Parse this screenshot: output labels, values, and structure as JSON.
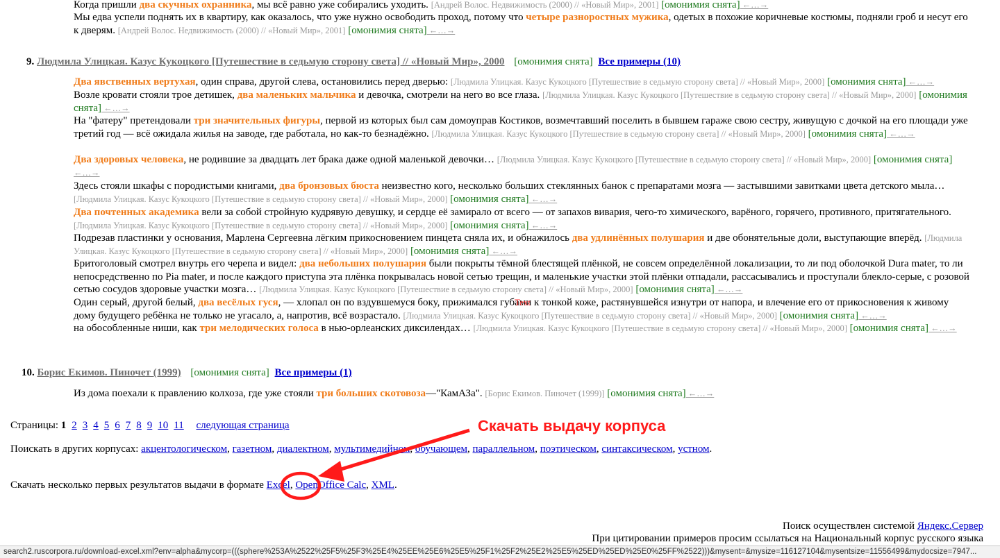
{
  "top_snippets": [
    {
      "parts": [
        {
          "t": "text",
          "v": "Когда пришли "
        },
        {
          "t": "kw",
          "v": "два скучных охранника"
        },
        {
          "t": "text",
          "v": ", мы всё равно уже собирались уходить. "
        },
        {
          "t": "src",
          "v": "[Андрей Волос. Недвижимость (2000) // «Новый Мир», 2001]"
        },
        {
          "t": "om",
          "v": " [омонимия снята]"
        },
        {
          "t": "arr",
          "v": " ←…→"
        }
      ]
    },
    {
      "parts": [
        {
          "t": "text",
          "v": "Мы едва успели поднять их в квартиру, как оказалось, что уже нужно освободить проход, потому что "
        },
        {
          "t": "kw",
          "v": "четыре разноростных мужика"
        },
        {
          "t": "text",
          "v": ", одетых в похожие коричневые костюмы, подняли гроб и несут его к дверям. "
        },
        {
          "t": "src",
          "v": "[Андрей Волос. Недвижимость (2000) // «Новый Мир», 2001]"
        },
        {
          "t": "om",
          "v": " [омонимия снята]"
        },
        {
          "t": "arr",
          "v": " ←…→"
        }
      ]
    }
  ],
  "doc9": {
    "number": "9.",
    "title": "Людмила Улицкая. Казус Кукоцкого [Путешествие в седьмую сторону света] // «Новый Мир», 2000",
    "omonimia": "[омонимия снята]",
    "all_examples": "Все примеры (10)",
    "snippets": [
      {
        "parts": [
          {
            "t": "kw",
            "v": "Два явственных вертухая"
          },
          {
            "t": "text",
            "v": ", один справа, другой слева, остановились перед дверью: "
          },
          {
            "t": "src",
            "v": "[Людмила Улицкая. Казус Кукоцкого [Путешествие в седьмую сторону света] // «Новый Мир», 2000]"
          },
          {
            "t": "om",
            "v": " [омонимия снята]"
          },
          {
            "t": "arr",
            "v": " ←…→"
          }
        ]
      },
      {
        "parts": [
          {
            "t": "text",
            "v": "Возле кровати стояли трое детишек, "
          },
          {
            "t": "kw",
            "v": "два маленьких мальчика"
          },
          {
            "t": "text",
            "v": " и девочка, смотрели на него во все глаза. "
          },
          {
            "t": "src",
            "v": "[Людмила Улицкая. Казус Кукоцкого [Путешествие в седьмую сторону света] // «Новый Мир», 2000]"
          },
          {
            "t": "om",
            "v": " [омонимия снята]"
          },
          {
            "t": "arr",
            "v": " ←…→"
          }
        ]
      },
      {
        "parts": [
          {
            "t": "text",
            "v": "На \"фатеру\" претендовали "
          },
          {
            "t": "kw",
            "v": "три значительных фигуры"
          },
          {
            "t": "text",
            "v": ", первой из которых был сам домоуправ Костиков, возмечтавший поселить в бывшем гараже свою сестру, живущую с дочкой на его площади уже третий год — всё ожидала жилья на заводе, где работала, но как-то безнадёжно. "
          },
          {
            "t": "src",
            "v": "[Людмила Улицкая. Казус Кукоцкого [Путешествие в седьмую сторону света] // «Новый Мир», 2000]"
          },
          {
            "t": "om",
            "v": " [омонимия снята]"
          },
          {
            "t": "arr",
            "v": " ←…→"
          }
        ]
      },
      {
        "parts": [
          {
            "t": "kw",
            "v": "Два здоровых человека"
          },
          {
            "t": "text",
            "v": ", не родившие за двадцать лет брака даже одной маленькой девочки… "
          },
          {
            "t": "src",
            "v": "[Людмила Улицкая. Казус Кукоцкого [Путешествие в седьмую сторону света] // «Новый Мир», 2000]"
          },
          {
            "t": "om",
            "v": " [омонимия снята]"
          },
          {
            "t": "arr",
            "v": " ←…→"
          }
        ]
      },
      {
        "parts": [
          {
            "t": "text",
            "v": "Здесь стояли шкафы с породистыми книгами, "
          },
          {
            "t": "kw",
            "v": "два бронзовых бюста"
          },
          {
            "t": "text",
            "v": " неизвестно кого, несколько больших стеклянных банок с препаратами мозга — застывшими завитками цвета детского мыла… "
          },
          {
            "t": "src",
            "v": "[Людмила Улицкая. Казус Кукоцкого [Путешествие в седьмую сторону света] // «Новый Мир», 2000]"
          },
          {
            "t": "om",
            "v": " [омонимия снята]"
          },
          {
            "t": "arr",
            "v": " ←…→"
          }
        ]
      },
      {
        "parts": [
          {
            "t": "kw",
            "v": "Два почтенных академика"
          },
          {
            "t": "text",
            "v": " вели за собой стройную кудрявую девушку, и сердце её замирало от всего — от запахов вивария, чего-то химического, варёного, горячего, противного, притягательного. "
          },
          {
            "t": "src",
            "v": "[Людмила Улицкая. Казус Кукоцкого [Путешествие в седьмую сторону света] // «Новый Мир», 2000]"
          },
          {
            "t": "om",
            "v": " [омонимия снята]"
          },
          {
            "t": "arr",
            "v": " ←…→"
          }
        ]
      },
      {
        "parts": [
          {
            "t": "text",
            "v": "Подрезав пластинки у основания, Марлена Сергеевна лёгким прикосновением пинцета сняла их, и обнажилось "
          },
          {
            "t": "kw",
            "v": "два удлинённых полушария"
          },
          {
            "t": "text",
            "v": " и две обонятельные доли, выступающие вперёд. "
          },
          {
            "t": "src",
            "v": "[Людмила Улицкая. Казус Кукоцкого [Путешествие в седьмую сторону света] // «Новый Мир», 2000]"
          },
          {
            "t": "om",
            "v": " [омонимия снята]"
          },
          {
            "t": "arr",
            "v": " ←…→"
          }
        ]
      },
      {
        "parts": [
          {
            "t": "text",
            "v": "Бритоголовый смотрел внутрь его черепа и видел: "
          },
          {
            "t": "kw",
            "v": "два небольших полушария"
          },
          {
            "t": "text",
            "v": " были покрыты тёмной блестящей плёнкой, не совсем определённой локализации, то ли под оболочкой Dura mater, то ли непосредственно по Pia mater, и после каждого приступа эта плёнка покрывалась новой сетью трещин, и маленькие участки этой плёнки отпадали, рассасывались и проступали блекло-серые, с розовой сетью сосудов здоровые участки мозга… "
          },
          {
            "t": "src",
            "v": "[Людмила Улицкая. Казус Кукоцкого [Путешествие в седьмую сторону света] // «Новый Мир», 2000]"
          },
          {
            "t": "om",
            "v": " [омонимия снята]"
          },
          {
            "t": "arr",
            "v": " ←…→"
          }
        ]
      },
      {
        "parts": [
          {
            "t": "text",
            "v": "Один серый, другой белый, "
          },
          {
            "t": "kw",
            "v": "два весёлых гуся"
          },
          {
            "t": "text",
            "v": ", — хлопал он по вздувшемуся боку, прижимался губами к тонкой коже, растянувшейся изнутри от напора, и влечение его от прикосновения к живому дому будущего ребёнка не только не угасало, а, напротив, всё возрастало. "
          },
          {
            "t": "src",
            "v": "[Людмила Улицкая. Казус Кукоцкого [Путешествие в седьмую сторону света] // «Новый Мир», 2000]"
          },
          {
            "t": "om",
            "v": " [омонимия снята]"
          },
          {
            "t": "arr",
            "v": " ←…→"
          }
        ]
      },
      {
        "parts": [
          {
            "t": "text",
            "v": "на обособленные ниши, как "
          },
          {
            "t": "kw",
            "v": "три мелодических голоса"
          },
          {
            "t": "text",
            "v": " в нью-орлеанских диксилендах… "
          },
          {
            "t": "src",
            "v": "[Людмила Улицкая. Казус Кукоцкого [Путешествие в седьмую сторону света] // «Новый Мир», 2000]"
          },
          {
            "t": "om",
            "v": " [омонимия снята]"
          },
          {
            "t": "arr",
            "v": " ←…→"
          }
        ]
      }
    ]
  },
  "doc10": {
    "number": "10.",
    "title": "Борис Екимов. Пиночет (1999)",
    "omonimia": "[омонимия снята]",
    "all_examples": "Все примеры (1)",
    "snippets": [
      {
        "parts": [
          {
            "t": "text",
            "v": "Из дома поехали к правлению колхоза, где уже стояли "
          },
          {
            "t": "kw",
            "v": "три больших скотовоза"
          },
          {
            "t": "text",
            "v": "—\"КамАЗа\". "
          },
          {
            "t": "src",
            "v": "[Борис Екимов. Пиночет (1999)]"
          },
          {
            "t": "om",
            "v": " [омонимия снята]"
          },
          {
            "t": "arr",
            "v": " ←…→"
          }
        ]
      }
    ]
  },
  "pagination": {
    "label": "Страницы:",
    "current": "1",
    "pages": [
      "2",
      "3",
      "4",
      "5",
      "6",
      "7",
      "8",
      "9",
      "10",
      "11"
    ],
    "next": "следующая страница"
  },
  "other_corpora": {
    "label": "Поискать в других корпусах:",
    "links": [
      "акцентологическом",
      "газетном",
      "диалектном",
      "мультимедийном",
      "обучающем",
      "параллельном",
      "поэтическом",
      "синтаксическом",
      "устном"
    ]
  },
  "download": {
    "label": "Скачать несколько первых результатов выдачи в формате",
    "formats": [
      "Excel",
      "OpenOffice Calc",
      "XML"
    ]
  },
  "annotation": {
    "text": "Скачать выдачу корпуса",
    "color": "#ff1a1a"
  },
  "tooltip_fragment": "Text",
  "footer": {
    "search_by": "Поиск осуществлен системой",
    "engine_link": "Яндекс.Сервер",
    "citation": "При цитировании примеров просим ссылаться на Национальный корпус русского языка"
  },
  "status_bar_url": "search2.ruscorpora.ru/download-excel.xml?env=alpha&mycorp=(((sphere%253A%2522%25F5%25F3%25E4%25EE%25E6%25E5%25F1%25F2%25E2%25E5%25ED%25ED%25E0%25FF%2522)))&mysent=&mysize=116127104&mysentsize=11556499&mydocsize=7947..."
}
